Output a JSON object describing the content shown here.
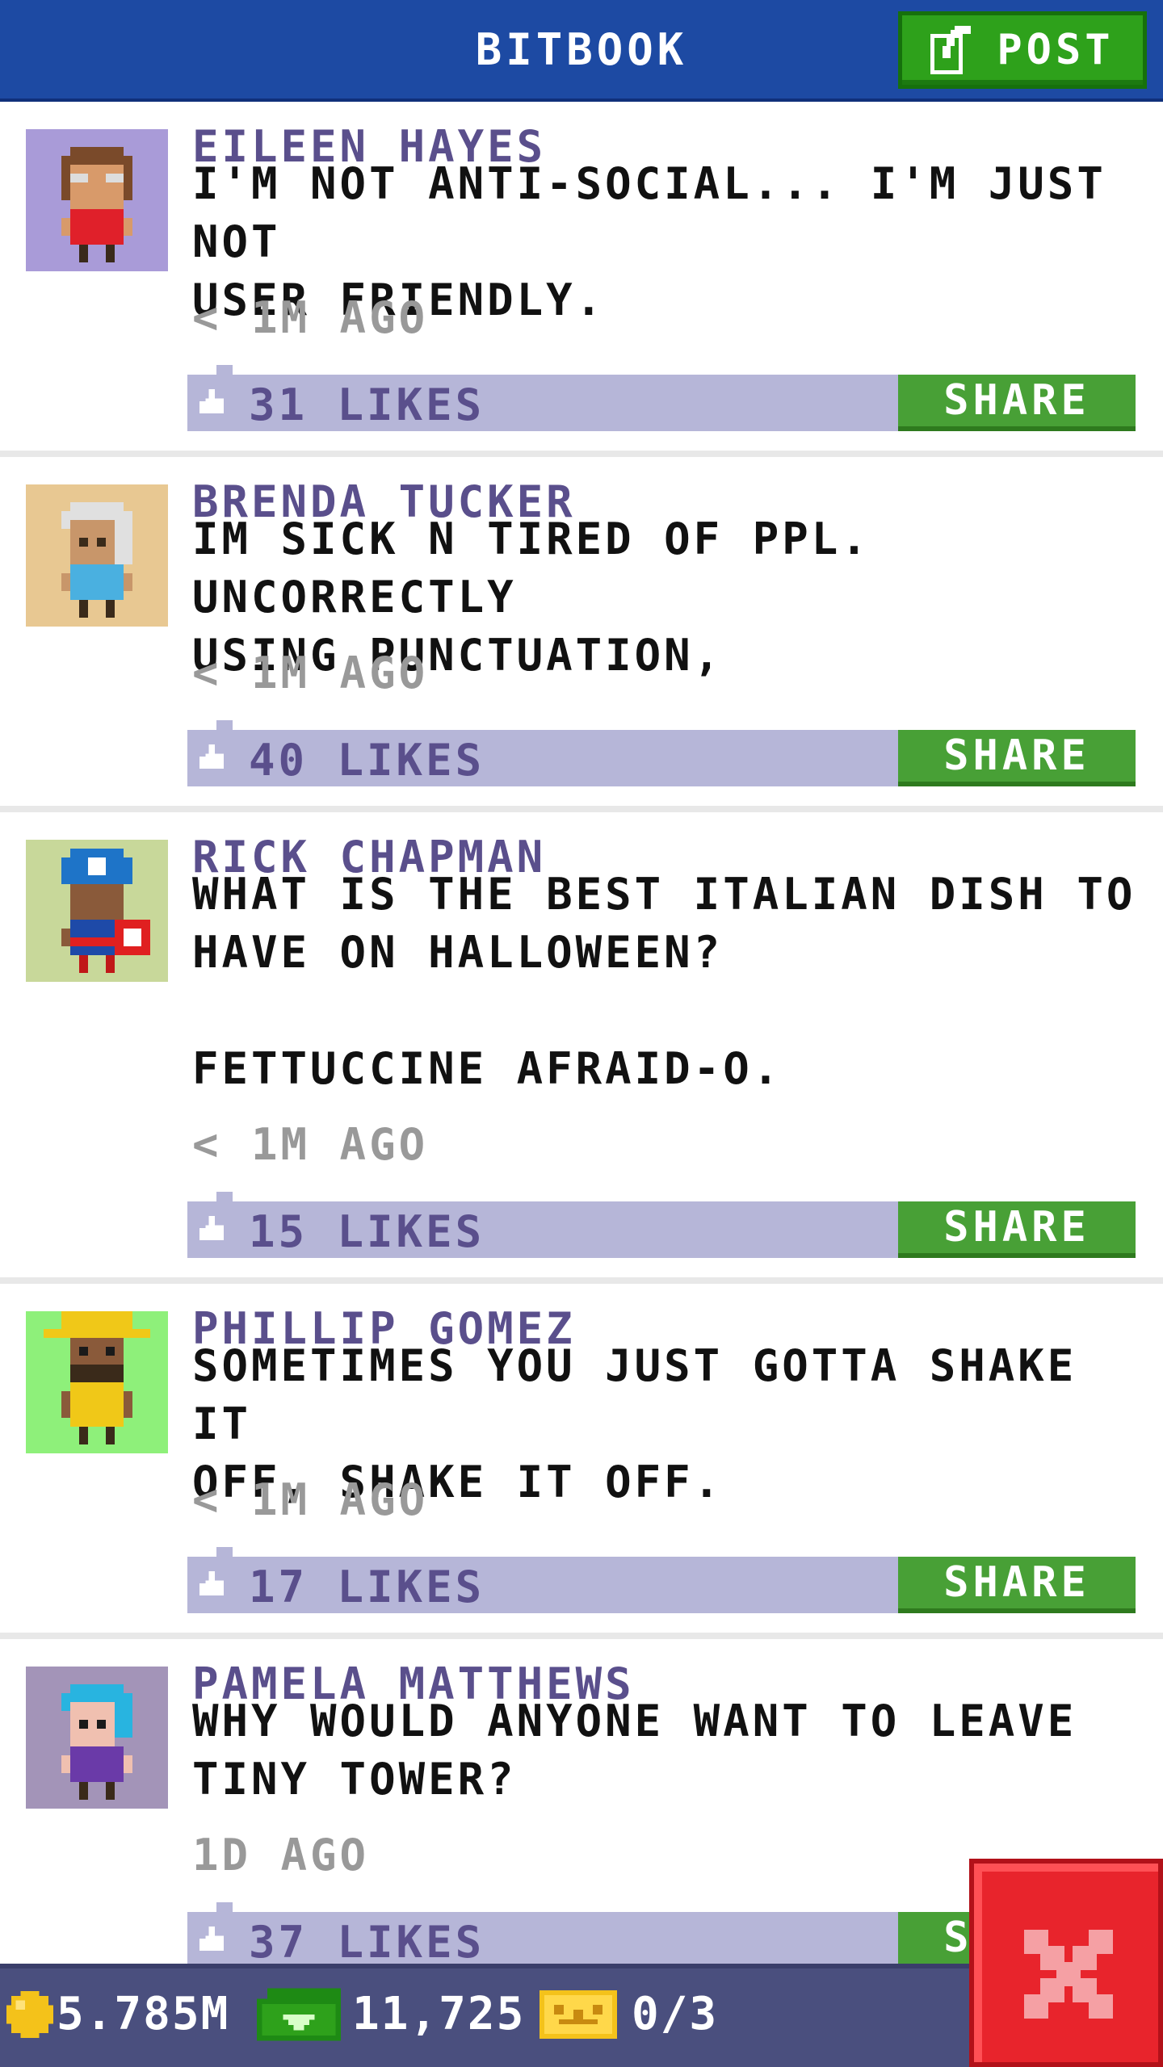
{
  "header": {
    "title": "BITBOOK",
    "post_label": "POST"
  },
  "posts": [
    {
      "author": "EILEEN HAYES",
      "message": "I'M NOT ANTI-SOCIAL... I'M JUST NOT\nUSER FRIENDLY.",
      "time": "< 1M AGO",
      "likes": "31 LIKES",
      "share_label": "SHARE",
      "avatar_bg": "#a99bd8"
    },
    {
      "author": "BRENDA TUCKER",
      "message": "IM SICK N TIRED OF PPL. UNCORRECTLY\nUSING PUNCTUATION,",
      "time": "< 1M AGO",
      "likes": "40 LIKES",
      "share_label": "SHARE",
      "avatar_bg": "#e8c892"
    },
    {
      "author": "RICK CHAPMAN",
      "message": "WHAT IS THE BEST ITALIAN DISH TO\nHAVE ON HALLOWEEN?\n\nFETTUCCINE AFRAID-O.",
      "time": "< 1M AGO",
      "likes": "15 LIKES",
      "share_label": "SHARE",
      "avatar_bg": "#c8d89a"
    },
    {
      "author": "PHILLIP GOMEZ",
      "message": "SOMETIMES YOU JUST GOTTA SHAKE IT\nOFF, SHAKE IT OFF.",
      "time": "< 1M AGO",
      "likes": "17 LIKES",
      "share_label": "SHARE",
      "avatar_bg": "#8ef07a"
    },
    {
      "author": "PAMELA MATTHEWS",
      "message": "WHY WOULD ANYONE WANT TO LEAVE\nTINY TOWER?",
      "time": "1D AGO",
      "likes": "37 LIKES",
      "share_label": "SHARE",
      "avatar_bg": "#a394b8"
    }
  ],
  "bottom_bar": {
    "coins": "5.785M",
    "bux": "11,725",
    "tickets": "0/3"
  },
  "colors": {
    "header": "#1d4aa3",
    "post_button": "#2ea11b",
    "like_bar": "#b6b6d8",
    "share_button": "#48a036",
    "author_text": "#5a4f8c",
    "bottom_bar": "#4a4f7e",
    "close_button": "#e8242c"
  },
  "icons": {
    "post": "edit-icon",
    "like": "thumbs-up-icon",
    "coin": "coin-icon",
    "bux": "bux-icon",
    "ticket": "vip-ticket-icon",
    "close": "close-icon"
  }
}
